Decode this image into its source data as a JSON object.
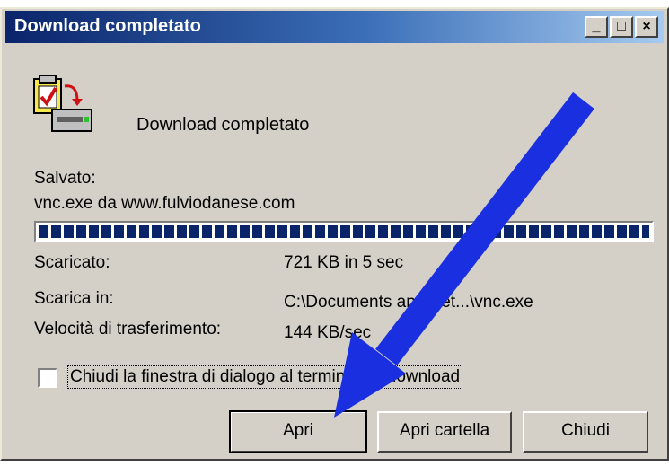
{
  "window": {
    "title": "Download completato",
    "controls": {
      "minimize": "_",
      "maximize": "□",
      "close": "×"
    }
  },
  "header": {
    "icon": "download-complete-icon",
    "text": "Download completato"
  },
  "saved": {
    "label": "Salvato:",
    "value": "vnc.exe da www.fulviodanese.com"
  },
  "progress": {
    "percent": 100
  },
  "details": [
    {
      "label": "Scaricato:",
      "value": "721 KB in 5 sec"
    },
    {
      "label": "Scarica in:",
      "value": "C:\\Documents and Set...\\vnc.exe"
    },
    {
      "label": "Velocità di trasferimento:",
      "value": "144 KB/sec"
    }
  ],
  "close_on_complete": {
    "label": "Chiudi la finestra di dialogo al termine del download",
    "checked": false
  },
  "buttons": {
    "open": "Apri",
    "open_folder": "Apri cartella",
    "close": "Chiudi"
  },
  "overlay": {
    "arrow_color": "#1a2fe0"
  }
}
